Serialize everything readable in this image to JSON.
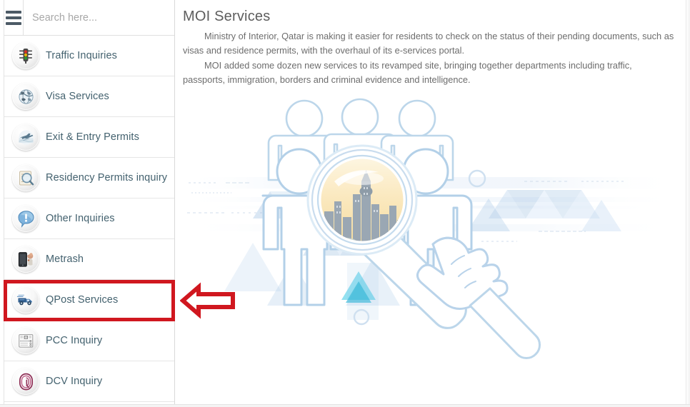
{
  "search": {
    "placeholder": "Search here...",
    "value": "",
    "menu_icon": "hamburger-menu-icon"
  },
  "sidebar": {
    "items": [
      {
        "label": "Traffic Inquiries",
        "icon": "traffic-light-icon",
        "highlighted": false
      },
      {
        "label": "Visa Services",
        "icon": "globe-visa-icon",
        "highlighted": false
      },
      {
        "label": "Exit & Entry Permits",
        "icon": "airplane-permit-icon",
        "highlighted": false
      },
      {
        "label": "Residency Permits inquiry",
        "icon": "magnifier-document-icon",
        "highlighted": false
      },
      {
        "label": "Other Inquiries",
        "icon": "exclamation-bubble-icon",
        "highlighted": false
      },
      {
        "label": "Metrash",
        "icon": "mobile-phone-icon",
        "highlighted": false
      },
      {
        "label": "QPost Services",
        "icon": "delivery-truck-icon",
        "highlighted": true
      },
      {
        "label": "PCC Inquiry",
        "icon": "certificate-document-icon",
        "highlighted": false
      },
      {
        "label": "DCV Inquiry",
        "icon": "fingerprint-icon",
        "highlighted": false
      }
    ]
  },
  "main": {
    "title": "MOI Services",
    "paragraphs": [
      "Ministry of Interior, Qatar is making it easier for residents to check on the status of their pending documents, such as visas and residence permits, with the overhaul of its e-services portal.",
      "MOI added some dozen new services to its revamped site, bringing together departments including traffic, passports, immigration, borders and criminal evidence and intelligence."
    ],
    "illustration_name": "people-magnifier-city-illustration"
  },
  "annotation": {
    "highlight_color": "#d0171f",
    "arrow_name": "left-pointing-arrow",
    "target_item": "QPost Services"
  },
  "colors": {
    "label_text": "#44626f",
    "title_text": "#5d5d5d",
    "body_text": "#6d6d6d",
    "accent_red": "#d0171f",
    "hamburger": "#4c5a66"
  }
}
